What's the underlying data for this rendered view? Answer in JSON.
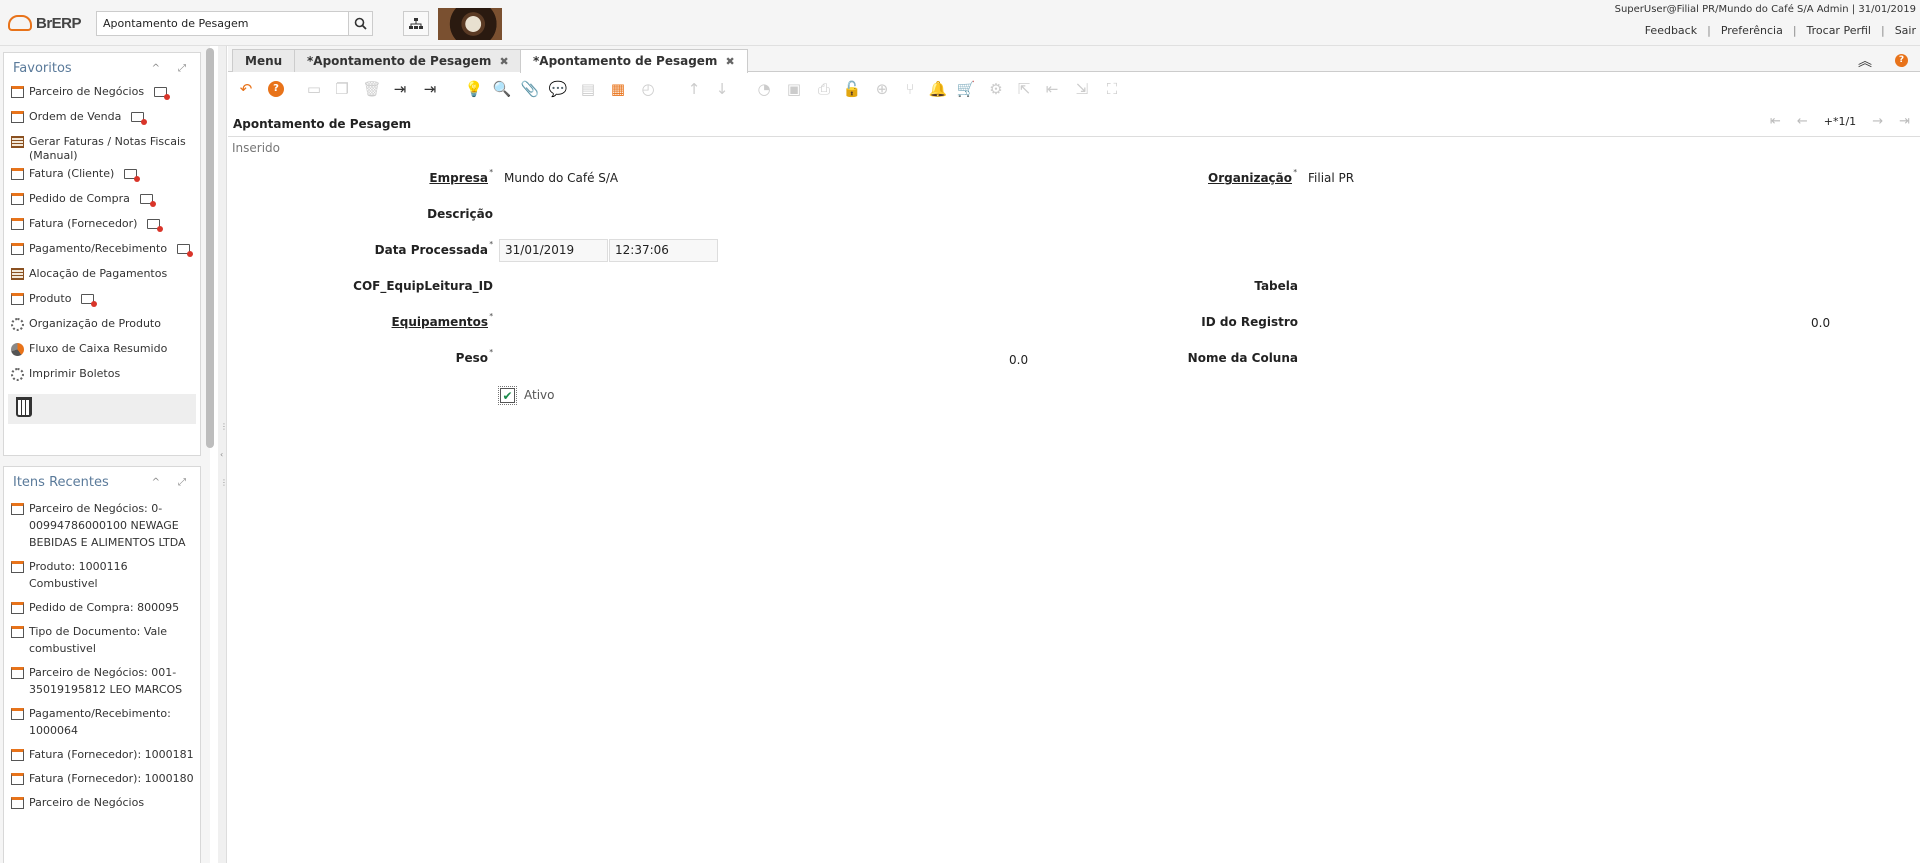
{
  "header": {
    "logo_text": "BrERP",
    "search_value": "Apontamento de Pesagem",
    "user_info": "SuperUser@Filial PR/Mundo do Café S/A Admin | 31/01/2019",
    "links": [
      "Feedback",
      "Preferência",
      "Trocar Perfil",
      "Sair"
    ]
  },
  "favorites": {
    "title": "Favoritos",
    "items": [
      {
        "label": "Parceiro de Negócios",
        "icon": "window-icon",
        "newwin": true
      },
      {
        "label": "Ordem de Venda",
        "icon": "window-icon",
        "newwin": true
      },
      {
        "label": "Gerar Faturas / Notas Fiscais (Manual)",
        "icon": "grid-icon",
        "newwin": false
      },
      {
        "label": "Fatura (Cliente)",
        "icon": "window-icon",
        "newwin": true
      },
      {
        "label": "Pedido de Compra",
        "icon": "window-icon",
        "newwin": true
      },
      {
        "label": "Fatura (Fornecedor)",
        "icon": "window-icon",
        "newwin": true
      },
      {
        "label": "Pagamento/Recebimento",
        "icon": "window-icon",
        "newwin": true
      },
      {
        "label": "Alocação de Pagamentos",
        "icon": "grid-icon",
        "newwin": false
      },
      {
        "label": "Produto",
        "icon": "window-icon",
        "newwin": true
      },
      {
        "label": "Organização de Produto",
        "icon": "gear-icon",
        "newwin": false
      },
      {
        "label": "Fluxo de Caixa Resumido",
        "icon": "pie-icon",
        "newwin": false
      },
      {
        "label": "Imprimir Boletos",
        "icon": "gear-icon",
        "newwin": false
      }
    ]
  },
  "recent": {
    "title": "Itens Recentes",
    "items": [
      "Parceiro de Negócios: 0-00994786000100 NEWAGE BEBIDAS E ALIMENTOS LTDA",
      "Produto: 1000116 Combustivel",
      "Pedido de Compra: 800095",
      "Tipo de Documento: Vale combustivel",
      "Parceiro de Negócios: 001-35019195812 LEO MARCOS",
      "Pagamento/Recebimento: 1000064",
      "Fatura (Fornecedor): 1000181",
      "Fatura (Fornecedor): 1000180",
      "Parceiro de Negócios"
    ]
  },
  "tabs": [
    "Menu",
    "*Apontamento de Pesagem",
    "*Apontamento de Pesagem"
  ],
  "form": {
    "title": "Apontamento de Pesagem",
    "record_position": "+*1/1",
    "status": "Inserido",
    "fields": {
      "empresa_label": "Empresa",
      "empresa_value": "Mundo do Café S/A",
      "organizacao_label": "Organização",
      "organizacao_value": "Filial PR",
      "descricao_label": "Descrição",
      "data_label": "Data Processada",
      "data_date": "31/01/2019",
      "data_time": "12:37:06",
      "equip_leitura_label": "COF_EquipLeitura_ID",
      "tabela_label": "Tabela",
      "equipamentos_label": "Equipamentos",
      "id_registro_label": "ID do Registro",
      "id_registro_value": "0.0",
      "peso_label": "Peso",
      "peso_value": "0.0",
      "nome_coluna_label": "Nome da Coluna",
      "ativo_label": "Ativo",
      "ativo_checked": true
    }
  },
  "colors": {
    "accent": "#e8731a",
    "panel_title": "#5a7a9a"
  }
}
